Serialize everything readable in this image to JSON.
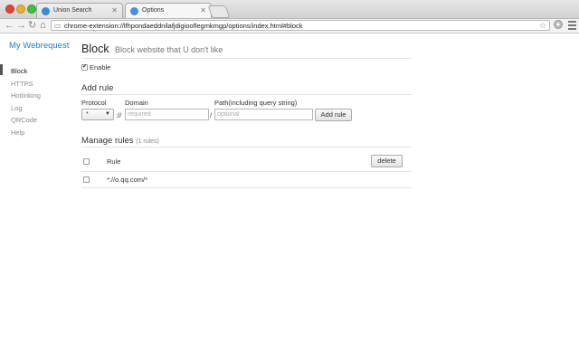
{
  "browser": {
    "tabs": [
      {
        "title": "Union Search",
        "active": false
      },
      {
        "title": "Options",
        "active": true
      }
    ],
    "url": "chrome-extension://lfhpondaeddnilafjdigiooflegmkmgp/options/index.html#block"
  },
  "sidebar": {
    "app_title": "My Webrequest",
    "items": [
      {
        "label": "Block",
        "active": true
      },
      {
        "label": "HTTPS",
        "active": false
      },
      {
        "label": "Hotlinking",
        "active": false
      },
      {
        "label": "Log",
        "active": false
      },
      {
        "label": "QRCode",
        "active": false
      },
      {
        "label": "Help",
        "active": false
      }
    ]
  },
  "main": {
    "title": "Block",
    "subtitle": "Block website that U don't like",
    "enable_label": "Enable",
    "enable_checked": true,
    "add_rule": {
      "heading": "Add rule",
      "protocol_label": "Protocol",
      "protocol_value": "*",
      "separator": "://",
      "domain_label": "Domain",
      "domain_placeholder": "required",
      "path_separator": "/",
      "path_label": "Path(including query string)",
      "path_placeholder": "optional",
      "button_label": "Add rule"
    },
    "manage": {
      "heading": "Manage rules",
      "count": "(1 rules)",
      "column_rule": "Rule",
      "delete_label": "delete",
      "rules": [
        "*://o.qq.com/*"
      ]
    }
  }
}
